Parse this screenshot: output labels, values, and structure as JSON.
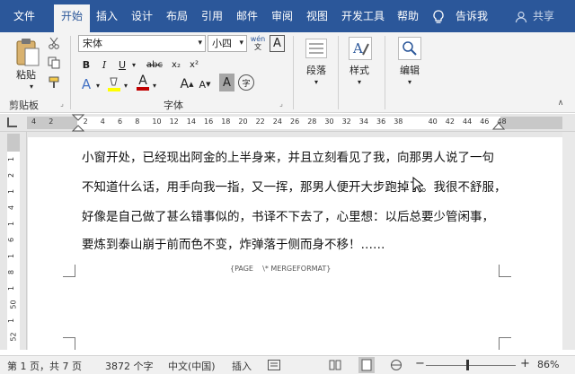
{
  "tabs": [
    "文件",
    "开始",
    "插入",
    "设计",
    "布局",
    "引用",
    "邮件",
    "审阅",
    "视图",
    "开发工具",
    "帮助"
  ],
  "tell_me": "告诉我",
  "share": "共享",
  "clipboard": {
    "paste": "粘贴",
    "label": "剪贴板"
  },
  "font": {
    "name": "宋体",
    "size": "小四",
    "phonetic": "wén",
    "label": "字体",
    "bold": "B",
    "italic": "I",
    "underline": "U",
    "strike": "abc",
    "sub": "x₂",
    "sup": "x²",
    "grow": "A",
    "shrink": "A",
    "char_shade": "A",
    "enclose": "字"
  },
  "paragraph": {
    "label": "段落"
  },
  "styles": {
    "label": "样式"
  },
  "editing": {
    "label": "编辑"
  },
  "ruler_h": [
    "4",
    "2",
    "",
    "2",
    "4",
    "6",
    "8",
    "10",
    "12",
    "14",
    "16",
    "18",
    "20",
    "22",
    "24",
    "26",
    "28",
    "30",
    "32",
    "34",
    "36",
    "38",
    "",
    "40",
    "42",
    "44",
    "46",
    "48"
  ],
  "ruler_v": [
    "1",
    "2",
    "1",
    "4",
    "1",
    "6",
    "1",
    "8",
    "1",
    "50",
    "1",
    "52"
  ],
  "document": {
    "lines": [
      "小窗开处，已经现出阿金的上半身来，并且立刻看见了我，向那男人说了一句",
      "不知道什么话，用手向我一指，又一挥，那男人便开大步跑掉了。我很不舒服，",
      "好像是自己做了甚么错事似的，书译不下去了，心里想：以后总要少管闲事，",
      "要炼到泰山崩于前而色不变，炸弹落于侧而身不移！……"
    ],
    "footer_field": "{PAGE    \\* MERGEFORMAT}"
  },
  "status": {
    "page": "第 1 页，共 7 页",
    "words": "3872 个字",
    "lang": "中文(中国)",
    "mode": "插入",
    "zoom": "86%"
  },
  "colors": {
    "brand": "#2b579a",
    "highlight": "#ffff00",
    "font_color": "#c00000"
  }
}
